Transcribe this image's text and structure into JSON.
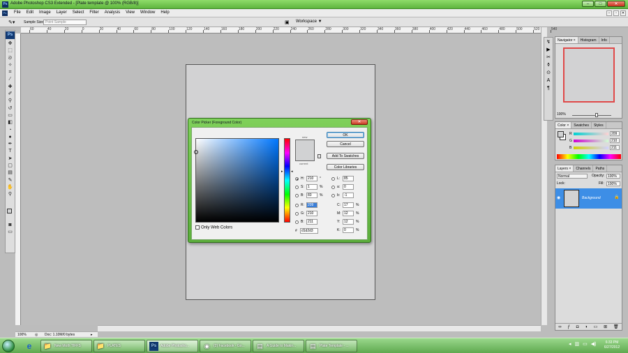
{
  "window": {
    "title": "Adobe Photoshop CS3 Extended - [Plate template @ 100% (RGB/8)]",
    "app_badge": "Ps",
    "buttons": [
      "–",
      "□",
      "✕"
    ]
  },
  "menubar": {
    "items": [
      "File",
      "Edit",
      "Image",
      "Layer",
      "Select",
      "Filter",
      "Analysis",
      "View",
      "Window",
      "Help"
    ],
    "doc_buttons": [
      "–",
      "▫",
      "✕"
    ]
  },
  "options": {
    "sample_size_label": "Sample Size:",
    "sample_size_value": "Point Sample",
    "workspace_label": "Workspace ▼"
  },
  "ruler": {
    "labels": [
      "60",
      "40",
      "20",
      "0",
      "20",
      "40",
      "60",
      "80",
      "100",
      "120",
      "140",
      "160",
      "180",
      "200",
      "220",
      "240",
      "260",
      "280",
      "300",
      "320",
      "340",
      "360",
      "380",
      "400",
      "420",
      "440",
      "460",
      "480",
      "500",
      "520",
      "540"
    ]
  },
  "status": {
    "zoom": "100%",
    "doc_info": "Doc: 1.10M/0 bytes"
  },
  "navigator": {
    "tabs": [
      "Navigator ×",
      "Histogram",
      "Info"
    ],
    "zoom": "100%"
  },
  "color_panel": {
    "tabs": [
      "Color ×",
      "Swatches",
      "Styles"
    ],
    "channels": [
      {
        "label": "R",
        "value": "209",
        "gradient": "linear-gradient(90deg,#00d2d3,#ffd2d3)"
      },
      {
        "label": "G",
        "value": "210",
        "gradient": "linear-gradient(90deg,#d100d3,#d1ffd3)"
      },
      {
        "label": "B",
        "value": "211",
        "gradient": "linear-gradient(90deg,#d1d200,#d1d2ff)"
      }
    ]
  },
  "layers_panel": {
    "tabs": [
      "Layers ×",
      "Channels",
      "Paths"
    ],
    "blend_mode": "Normal",
    "opacity_label": "Opacity:",
    "opacity": "100%",
    "lock_label": "Lock:",
    "fill_label": "Fill:",
    "fill": "100%",
    "layer_name": "Background"
  },
  "dialog": {
    "title": "Color Picker (Foreground Color)",
    "new_label": "new",
    "current_label": "current",
    "buttons": {
      "ok": "OK",
      "cancel": "Cancel",
      "add_swatches": "Add To Swatches",
      "color_libraries": "Color Libraries"
    },
    "only_web_colors": "Only Web Colors",
    "hsb": [
      {
        "label": "H:",
        "value": "210",
        "unit": "°",
        "selected": true
      },
      {
        "label": "S:",
        "value": "1",
        "unit": "%"
      },
      {
        "label": "B:",
        "value": "83",
        "unit": "%"
      }
    ],
    "rgb": [
      {
        "label": "R:",
        "value": "209"
      },
      {
        "label": "G:",
        "value": "210"
      },
      {
        "label": "B:",
        "value": "211"
      }
    ],
    "lab": [
      {
        "label": "L:",
        "value": "85"
      },
      {
        "label": "a:",
        "value": "0"
      },
      {
        "label": "b:",
        "value": "-1"
      }
    ],
    "cmyk": [
      {
        "label": "C:",
        "value": "17",
        "unit": "%"
      },
      {
        "label": "M:",
        "value": "12",
        "unit": "%"
      },
      {
        "label": "Y:",
        "value": "12",
        "unit": "%"
      },
      {
        "label": "K:",
        "value": "0",
        "unit": "%"
      }
    ],
    "hex_label": "#",
    "hex": "d1d2d3",
    "color": "#d1d2d3"
  },
  "taskbar": {
    "tasks": [
      {
        "label": "New Moth TIFFS",
        "icon": "folder-icon"
      },
      {
        "label": "PLATES",
        "icon": "folder-icon"
      },
      {
        "label": "Adobe Photosho...",
        "icon": "photoshop-icon",
        "active": true
      },
      {
        "label": "(2) Facebook - Go...",
        "icon": "chrome-icon"
      },
      {
        "label": "A Guide to Makin...",
        "icon": "document-icon"
      },
      {
        "label": "Plate Template - ...",
        "icon": "document-icon"
      }
    ],
    "time": "6:33 PM",
    "date": "6/27/2012"
  }
}
